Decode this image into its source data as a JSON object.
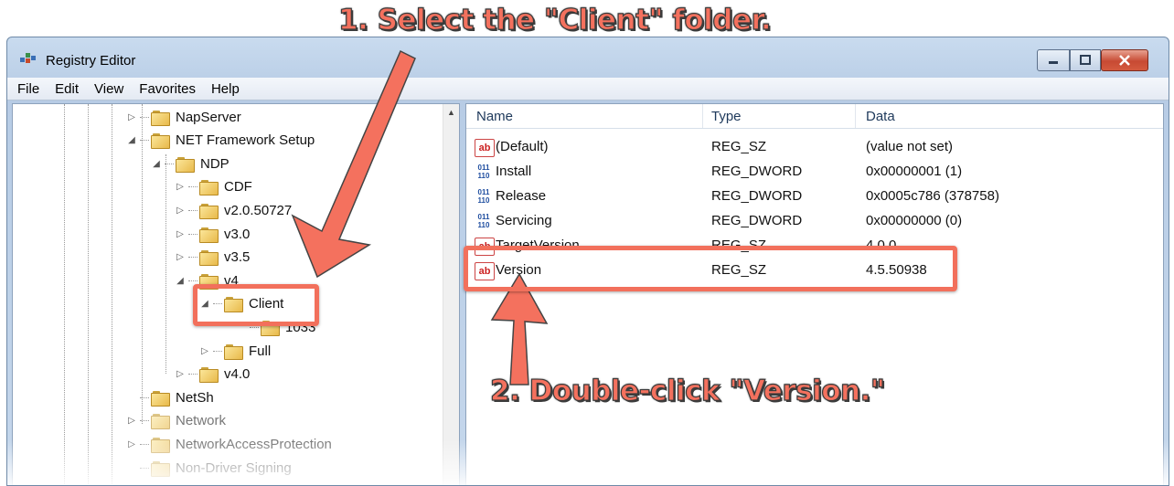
{
  "window": {
    "title": "Registry Editor",
    "accent_color": "#f2705c"
  },
  "menu": [
    "File",
    "Edit",
    "View",
    "Favorites",
    "Help"
  ],
  "tree": [
    {
      "label": "NapServer",
      "expander": "▷",
      "depth": 0
    },
    {
      "label": "NET Framework Setup",
      "expander": "◢",
      "depth": 0
    },
    {
      "label": "NDP",
      "expander": "◢",
      "depth": 1
    },
    {
      "label": "CDF",
      "expander": "▷",
      "depth": 2
    },
    {
      "label": "v2.0.50727",
      "expander": "▷",
      "depth": 2
    },
    {
      "label": "v3.0",
      "expander": "▷",
      "depth": 2
    },
    {
      "label": "v3.5",
      "expander": "▷",
      "depth": 2
    },
    {
      "label": "v4",
      "expander": "◢",
      "depth": 2
    },
    {
      "label": "Client",
      "expander": "◢",
      "depth": 3
    },
    {
      "label": "1033",
      "expander": "",
      "depth": 4
    },
    {
      "label": "Full",
      "expander": "▷",
      "depth": 3
    },
    {
      "label": "v4.0",
      "expander": "▷",
      "depth": 2
    },
    {
      "label": "NetSh",
      "expander": "",
      "depth": 0
    },
    {
      "label": "Network",
      "expander": "▷",
      "depth": 0
    },
    {
      "label": "NetworkAccessProtection",
      "expander": "▷",
      "depth": 0
    },
    {
      "label": "Non-Driver Signing",
      "expander": "",
      "depth": 0
    }
  ],
  "columns": {
    "name": "Name",
    "type": "Type",
    "data": "Data"
  },
  "values": [
    {
      "icon": "string-value-icon",
      "name": "(Default)",
      "type": "REG_SZ",
      "data": "(value not set)"
    },
    {
      "icon": "dword-value-icon",
      "name": "Install",
      "type": "REG_DWORD",
      "data": "0x00000001 (1)"
    },
    {
      "icon": "dword-value-icon",
      "name": "Release",
      "type": "REG_DWORD",
      "data": "0x0005c786 (378758)"
    },
    {
      "icon": "dword-value-icon",
      "name": "Servicing",
      "type": "REG_DWORD",
      "data": "0x00000000 (0)"
    },
    {
      "icon": "string-value-icon",
      "name": "TargetVersion",
      "type": "REG_SZ",
      "data": "4.0.0"
    },
    {
      "icon": "string-value-icon",
      "name": "Version",
      "type": "REG_SZ",
      "data": "4.5.50938"
    }
  ],
  "annotations": {
    "step1": "1. Select the \"Client\" folder.",
    "step2": "2. Double-click \"Version.\""
  },
  "icons": {
    "string_glyph": "ab",
    "dword_glyph_top": "011",
    "dword_glyph_bottom": "110"
  }
}
